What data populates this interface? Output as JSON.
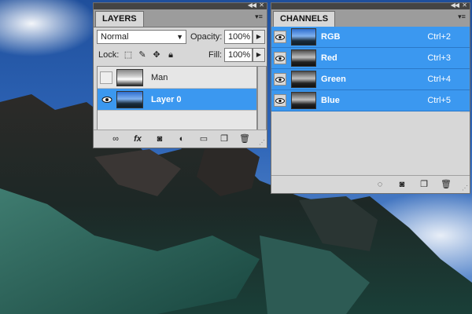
{
  "layers_panel": {
    "tab": "LAYERS",
    "blend_mode": "Normal",
    "opacity_label": "Opacity:",
    "opacity": "100%",
    "lock_label": "Lock:",
    "fill_label": "Fill:",
    "fill": "100%",
    "layers": [
      {
        "name": "Man",
        "visible": false,
        "selected": false
      },
      {
        "name": "Layer 0",
        "visible": true,
        "selected": true
      }
    ]
  },
  "channels_panel": {
    "tab": "CHANNELS",
    "channels": [
      {
        "name": "RGB",
        "shortcut": "Ctrl+2"
      },
      {
        "name": "Red",
        "shortcut": "Ctrl+3"
      },
      {
        "name": "Green",
        "shortcut": "Ctrl+4"
      },
      {
        "name": "Blue",
        "shortcut": "Ctrl+5"
      }
    ]
  },
  "colors": {
    "selection": "#3b98f0",
    "panel": "#d7d7d7"
  }
}
